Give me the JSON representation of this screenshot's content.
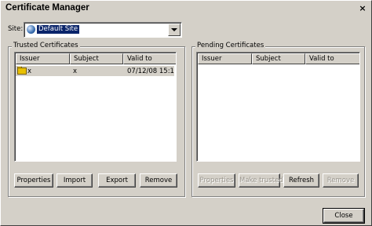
{
  "window": {
    "title": "Certificate Manager",
    "close_glyph": "×"
  },
  "site": {
    "label": "Site:",
    "value": "Default Site",
    "icon": "globe-icon"
  },
  "trusted": {
    "group_label": "Trusted Certificates",
    "columns": [
      "Issuer",
      "Subject",
      "Valid to"
    ],
    "rows": [
      {
        "issuer": "x",
        "subject": "x",
        "valid_to": "07/12/08 15:1...",
        "icon": "folder-icon"
      }
    ],
    "buttons": {
      "properties": "Properties",
      "import": "Import",
      "export": "Export",
      "remove": "Remove"
    }
  },
  "pending": {
    "group_label": "Pending Certificates",
    "columns": [
      "Issuer",
      "Subject",
      "Valid to"
    ],
    "buttons": {
      "properties": "Properties",
      "make_trusted": "Make trusted",
      "refresh": "Refresh",
      "remove": "Remove"
    }
  },
  "footer": {
    "close_label": "Close"
  }
}
